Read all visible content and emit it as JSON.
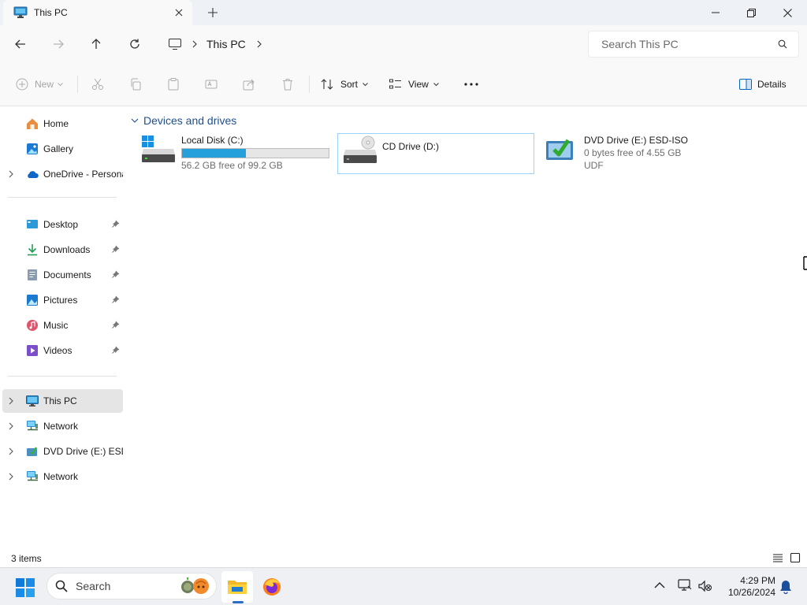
{
  "window": {
    "tab_title": "This PC",
    "new_tab": "+",
    "controls": {
      "minimize": "minimize",
      "maximize": "restore",
      "close": "close"
    }
  },
  "address": {
    "breadcrumb": [
      "This PC"
    ],
    "search_placeholder": "Search This PC"
  },
  "toolbar": {
    "new_label": "New",
    "sort_label": "Sort",
    "view_label": "View",
    "details_label": "Details",
    "disabled_actions": [
      "cut",
      "copy",
      "paste",
      "rename",
      "share",
      "delete"
    ]
  },
  "sidebar": {
    "items": [
      {
        "label": "Home",
        "icon": "home-icon",
        "expandable": false
      },
      {
        "label": "Gallery",
        "icon": "gallery-icon",
        "expandable": false
      },
      {
        "label": "OneDrive - Persona",
        "icon": "onedrive-icon",
        "expandable": true
      },
      {
        "label": "Desktop",
        "icon": "desktop-icon",
        "pinned": true
      },
      {
        "label": "Downloads",
        "icon": "downloads-icon",
        "pinned": true
      },
      {
        "label": "Documents",
        "icon": "documents-icon",
        "pinned": true
      },
      {
        "label": "Pictures",
        "icon": "pictures-icon",
        "pinned": true
      },
      {
        "label": "Music",
        "icon": "music-icon",
        "pinned": true
      },
      {
        "label": "Videos",
        "icon": "videos-icon",
        "pinned": true
      },
      {
        "label": "This PC",
        "icon": "this-pc-icon",
        "expandable": true,
        "selected": true
      },
      {
        "label": "Network",
        "icon": "network-icon",
        "expandable": true
      },
      {
        "label": "DVD Drive (E:) ESD-",
        "icon": "dvd-drive-icon",
        "expandable": true
      },
      {
        "label": "Network",
        "icon": "network-icon",
        "expandable": true
      }
    ]
  },
  "content": {
    "group_title": "Devices and drives",
    "drives": [
      {
        "name": "Local Disk (C:)",
        "free": "56.2 GB free of 99.2 GB",
        "used_fraction": 0.433,
        "icon": "windows-disk-icon"
      },
      {
        "name": "CD Drive (D:)",
        "icon": "cd-drive-icon",
        "focused": true
      },
      {
        "name": "DVD Drive (E:) ESD-ISO",
        "free": "0 bytes free of 4.55 GB",
        "fs": "UDF",
        "icon": "dvd-install-icon"
      }
    ]
  },
  "status": {
    "item_count": "3 items"
  },
  "taskbar": {
    "search_label": "Search",
    "time": "4:29 PM",
    "date": "10/26/2024"
  },
  "colors": {
    "accent": "#0067c0",
    "progress": "#26a0da",
    "selected_bg": "#e5e5e5",
    "group_title": "#1f4f8a"
  }
}
